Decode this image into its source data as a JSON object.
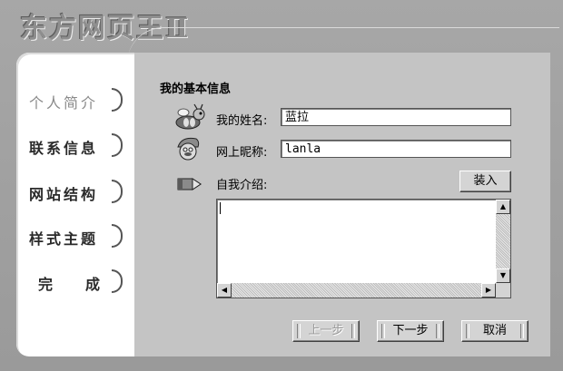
{
  "app": {
    "title": "东方网页王Ⅱ"
  },
  "sidebar": {
    "items": [
      {
        "label": "个人简介",
        "active": true
      },
      {
        "label": "联系信息",
        "active": false
      },
      {
        "label": "网站结构",
        "active": false
      },
      {
        "label": "样式主题",
        "active": false
      },
      {
        "label": "完　成",
        "active": false
      }
    ]
  },
  "form": {
    "section_title": "我的基本信息",
    "name_label": "我的姓名:",
    "name_value": "蓝拉",
    "nickname_label": "网上昵称:",
    "nickname_value": "lanla",
    "intro_label": "自我介绍:",
    "load_button": "装入",
    "intro_value": ""
  },
  "footer": {
    "prev_label": "上一步",
    "next_label": "下一步",
    "cancel_label": "取消"
  },
  "icons": [
    "bee-mascot-icon",
    "smurf-mascot-icon",
    "pencil-icon"
  ],
  "colors": {
    "background": "#9e9e9e",
    "sidebar": "#ffffff",
    "panel": "#c4c4c4"
  }
}
